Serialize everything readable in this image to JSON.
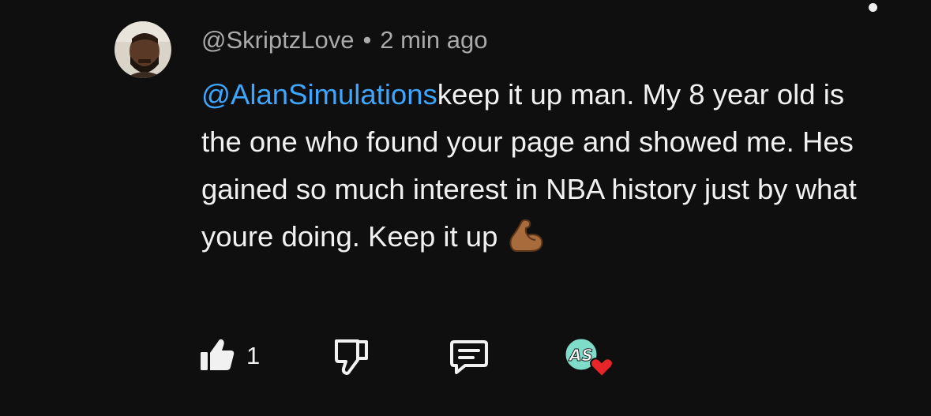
{
  "comment": {
    "username": "@SkriptzLove",
    "separator": "•",
    "timestamp": "2 min ago",
    "mention": "@AlanSimulations",
    "body": "keep it up man. My 8 year old is the one who found your page and showed me. Hes gained so much interest in NBA history just by what youre doing. Keep it up",
    "emoji_icon": "flexed-biceps-emoji"
  },
  "actions": {
    "like_count": "1",
    "like_icon": "thumbs-up-icon",
    "dislike_icon": "thumbs-down-icon",
    "reply_icon": "reply-comment-icon",
    "creator_heart_initials": "AS"
  },
  "colors": {
    "background": "#0f0f0f",
    "text": "#f1f1f1",
    "secondary_text": "#aaaaaa",
    "mention": "#3ea6ff",
    "heart": "#e8262a",
    "badge": "#7fdcc8"
  }
}
